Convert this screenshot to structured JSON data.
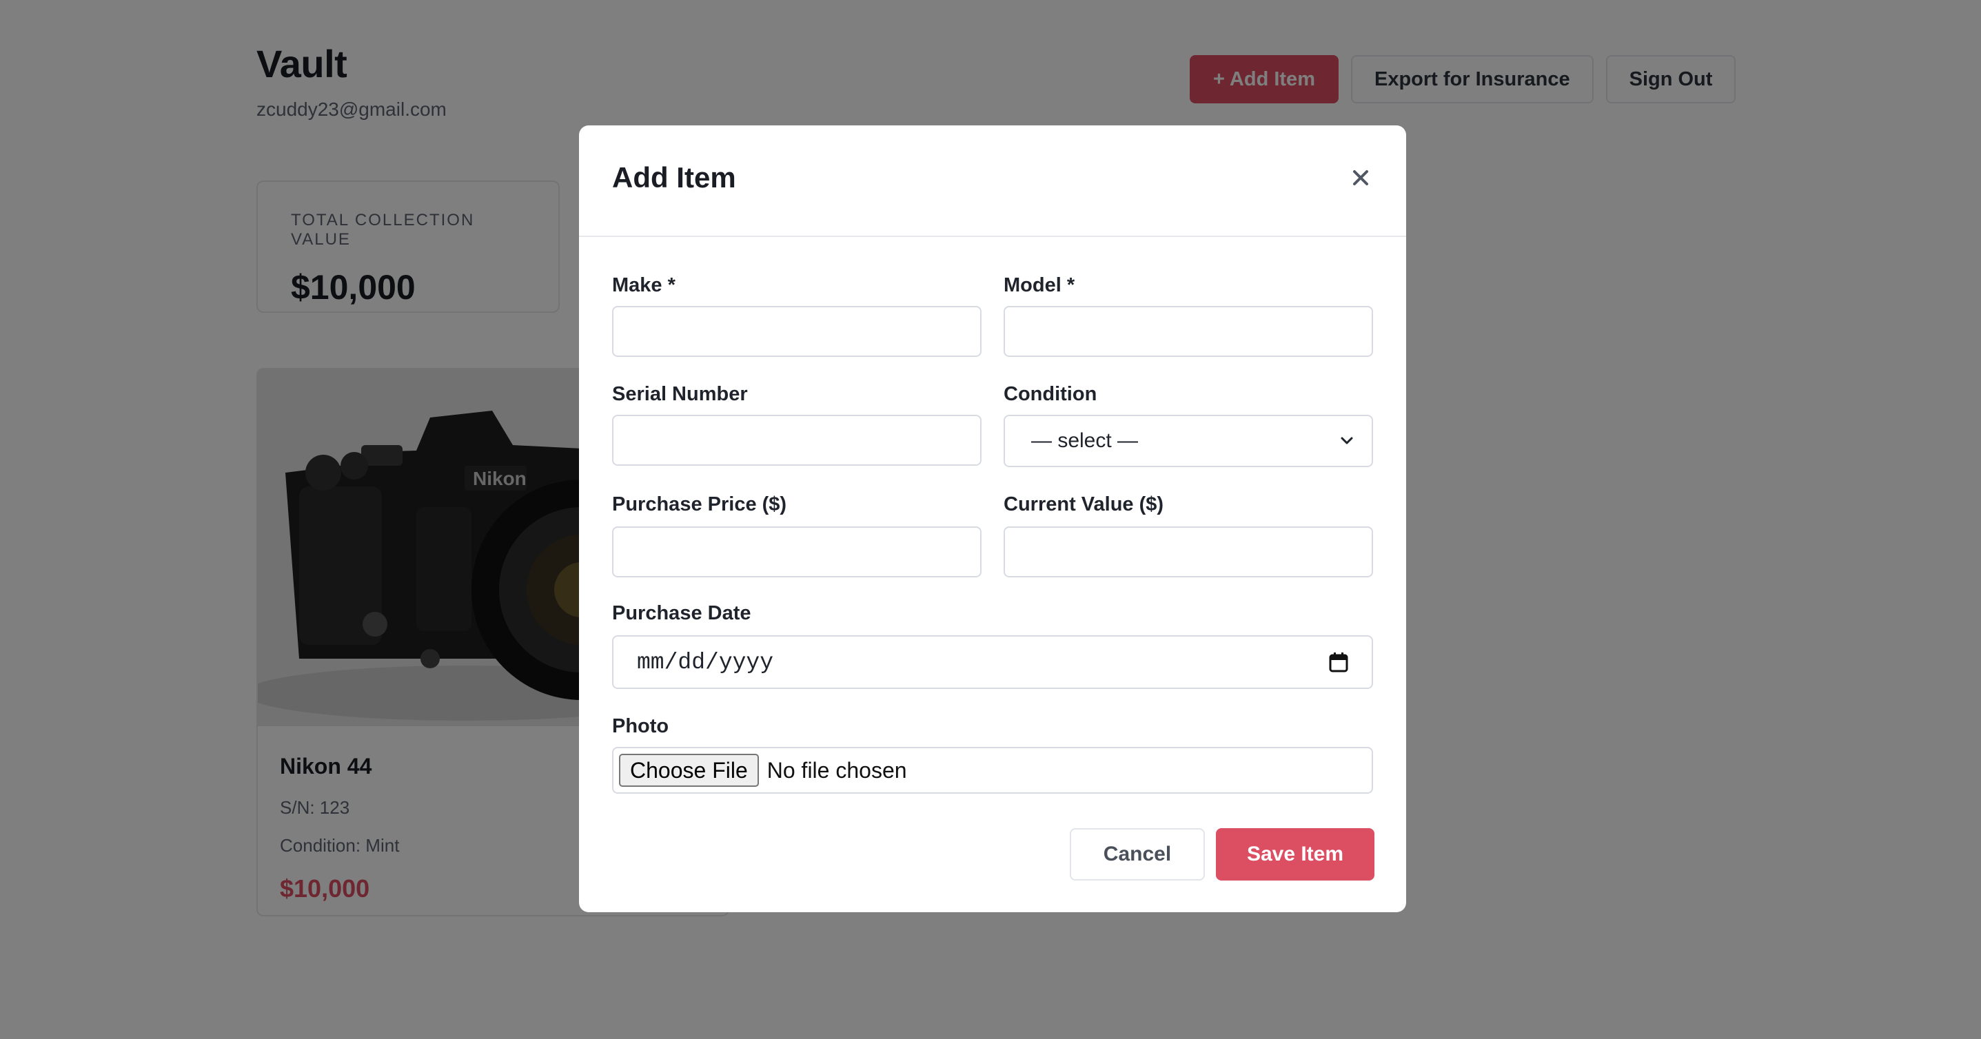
{
  "header": {
    "title": "Vault",
    "email": "zcuddy23@gmail.com",
    "add_item_label": "+ Add Item",
    "export_label": "Export for Insurance",
    "sign_out_label": "Sign Out"
  },
  "stats": {
    "total_label": "TOTAL COLLECTION VALUE",
    "total_value": "$10,000"
  },
  "items": [
    {
      "name": "Nikon 44",
      "serial": "S/N: 123",
      "condition": "Condition: Mint",
      "value": "$10,000",
      "photo_icon": "camera-photo"
    }
  ],
  "modal": {
    "title": "Add Item",
    "close_icon": "close-icon",
    "fields": {
      "make_label": "Make *",
      "make_value": "",
      "model_label": "Model *",
      "model_value": "",
      "serial_label": "Serial Number",
      "serial_value": "",
      "condition_label": "Condition",
      "condition_selected": "— select —",
      "purchase_price_label": "Purchase Price ($)",
      "purchase_price_value": "",
      "current_value_label": "Current Value ($)",
      "current_value_value": "",
      "purchase_date_label": "Purchase Date",
      "purchase_date_placeholder": "mm/dd/yyyy",
      "photo_label": "Photo",
      "choose_file_label": "Choose File",
      "file_status": "No file chosen"
    },
    "cancel_label": "Cancel",
    "save_label": "Save Item"
  },
  "colors": {
    "accent": "#dc4f63",
    "overlay": "rgba(0,0,0,0.5)"
  }
}
